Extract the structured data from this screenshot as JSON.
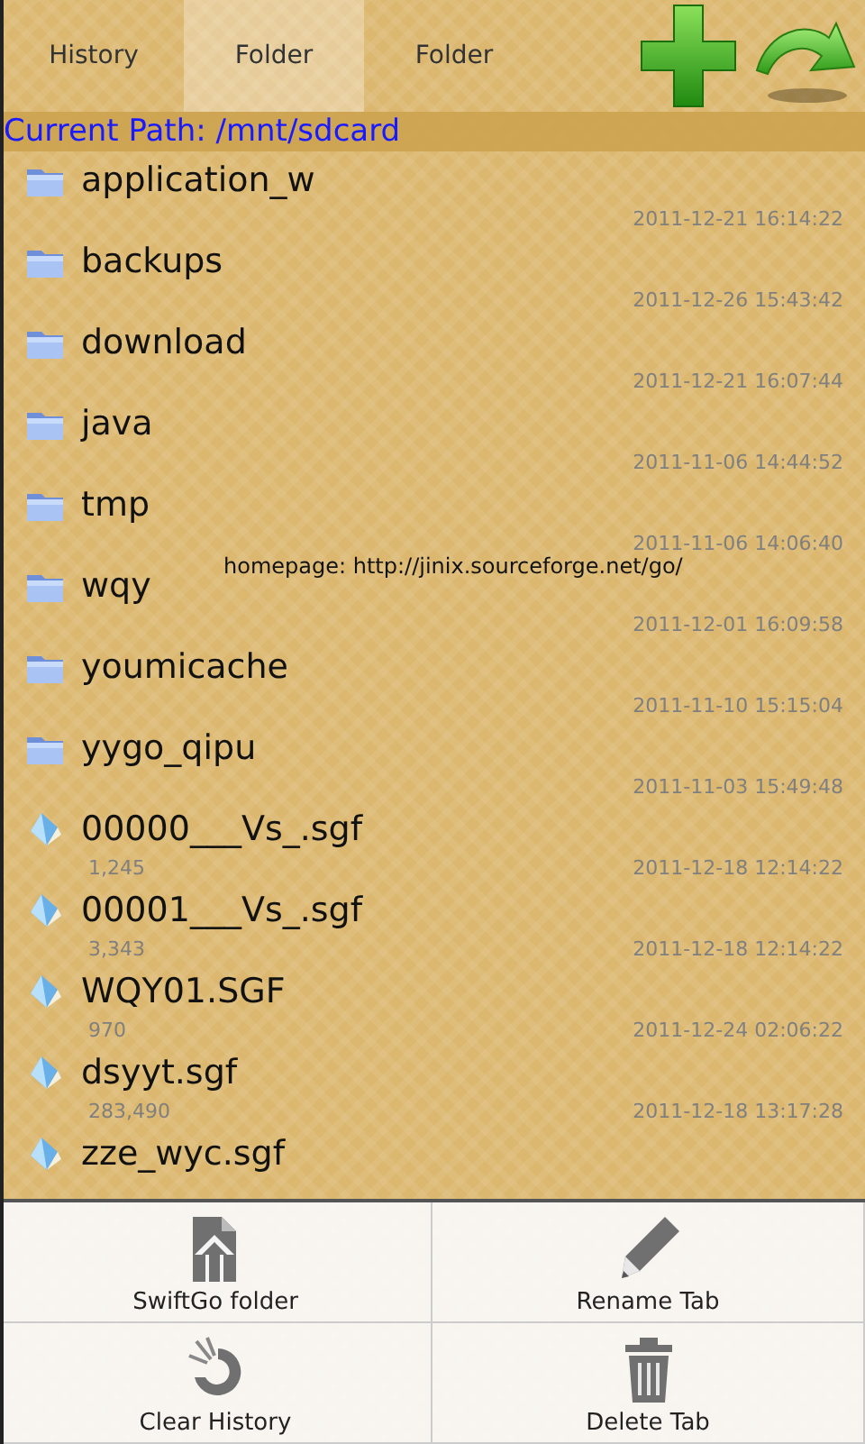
{
  "tabs": [
    {
      "label": "History",
      "selected": false
    },
    {
      "label": "Folder",
      "selected": true
    },
    {
      "label": "Folder",
      "selected": false
    }
  ],
  "toolbar": [
    {
      "kind": "add"
    },
    {
      "kind": "go"
    }
  ],
  "current_path": "Current Path: /mnt/sdcard",
  "homepage": "homepage: http://jinix.sourceforge.net/go/",
  "files": [
    {
      "kind": "folder",
      "name": "application_w",
      "date": "2011-12-21 16:14:22"
    },
    {
      "kind": "folder",
      "name": "backups",
      "date": "2011-12-26 15:43:42"
    },
    {
      "kind": "folder",
      "name": "download",
      "date": "2011-12-21 16:07:44"
    },
    {
      "kind": "folder",
      "name": "java",
      "date": "2011-11-06 14:44:52"
    },
    {
      "kind": "folder",
      "name": "tmp",
      "date": "2011-11-06 14:06:40"
    },
    {
      "kind": "folder",
      "name": "wqy",
      "date": "2011-12-01 16:09:58"
    },
    {
      "kind": "folder",
      "name": "youmicache",
      "date": "2011-11-10 15:15:04"
    },
    {
      "kind": "folder",
      "name": "yygo_qipu",
      "date": "2011-11-03 15:49:48"
    },
    {
      "kind": "file",
      "name": "00000___Vs_.sgf",
      "size": "1,245",
      "date": "2011-12-18 12:14:22"
    },
    {
      "kind": "file",
      "name": "00001___Vs_.sgf",
      "size": "3,343",
      "date": "2011-12-18 12:14:22"
    },
    {
      "kind": "file",
      "name": "WQY01.SGF",
      "size": "970",
      "date": "2011-12-24 02:06:22"
    },
    {
      "kind": "file",
      "name": "dsyyt.sgf",
      "size": "283,490",
      "date": "2011-12-18 13:17:28"
    },
    {
      "kind": "file",
      "name": "zze_wyc.sgf"
    }
  ],
  "menu": [
    {
      "kind": "home",
      "label": "SwiftGo folder"
    },
    {
      "kind": "rename",
      "label": "Rename Tab"
    },
    {
      "kind": "clear",
      "label": "Clear History"
    },
    {
      "kind": "delete",
      "label": "Delete Tab"
    }
  ]
}
